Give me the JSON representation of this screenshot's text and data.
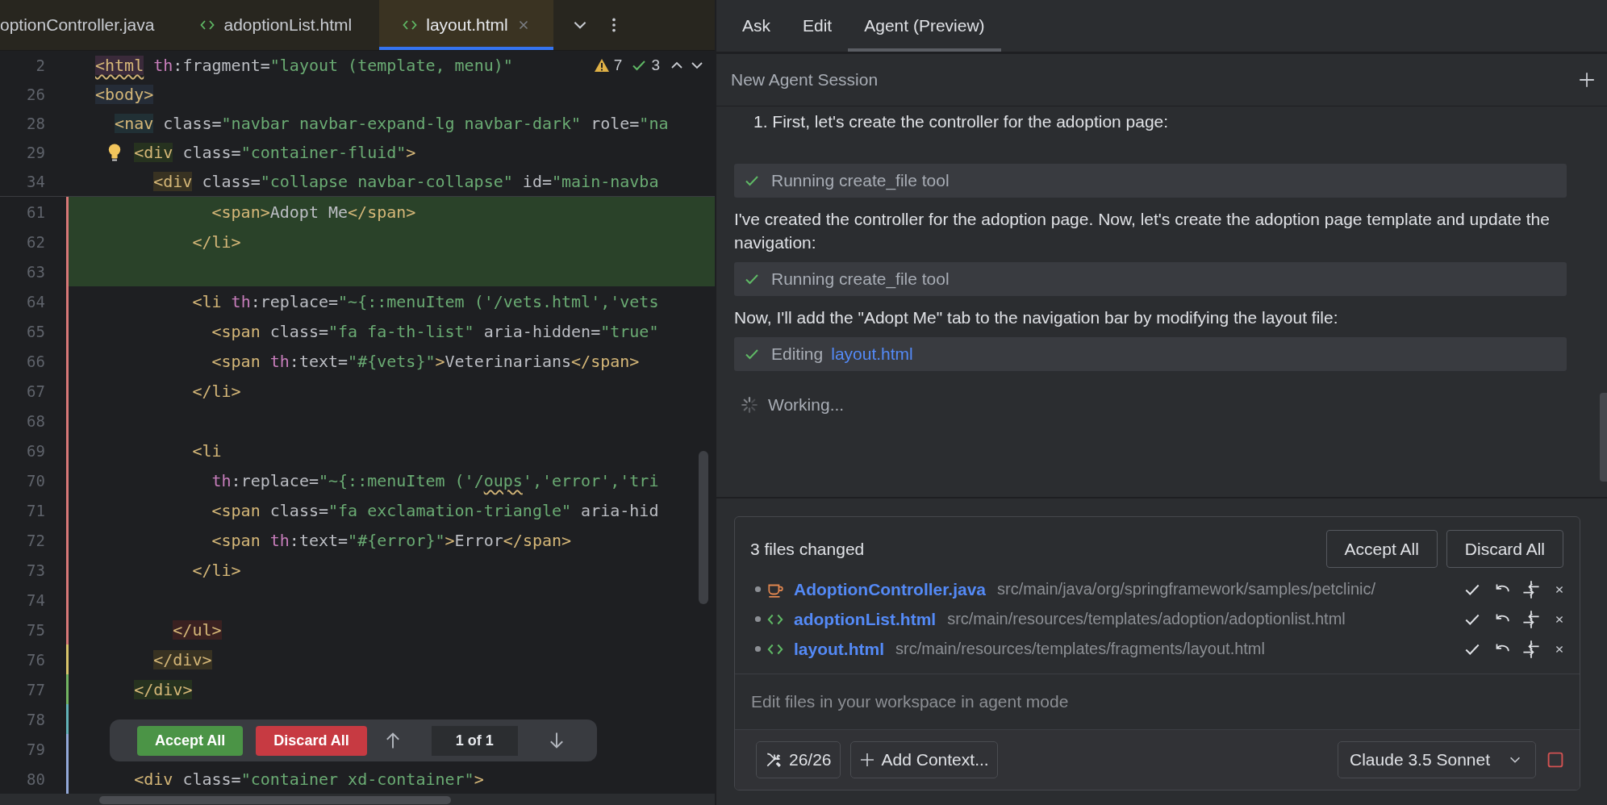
{
  "editor": {
    "tabs": [
      {
        "label": "optionController.java",
        "selected": false
      },
      {
        "label": "adoptionList.html",
        "kind": "html",
        "selected": false
      },
      {
        "label": "layout.html",
        "kind": "html",
        "selected": true
      }
    ],
    "inspections": {
      "warnings": "7",
      "checks": "3"
    },
    "sticky_lines": [
      {
        "number": "2",
        "segments": [
          {
            "kind": "tag",
            "text": "<html",
            "color": "#3a2a3a",
            "squiggly": true
          },
          {
            "kind": "ns",
            "text": " th"
          },
          {
            "kind": "attr",
            "text": ":fragment="
          },
          {
            "kind": "value",
            "text": "\"layout (template, menu)\""
          }
        ]
      },
      {
        "number": "26",
        "segments": [
          {
            "kind": "tag",
            "text": "<body>",
            "color": "#252c37"
          }
        ]
      },
      {
        "number": "28",
        "segments": [
          {
            "kind": "tag",
            "text": "  <nav",
            "color": "#213035"
          },
          {
            "kind": "attr",
            "text": " class="
          },
          {
            "kind": "value",
            "text": "\"navbar navbar-expand-lg navbar-dark\""
          },
          {
            "kind": "attr",
            "text": " role="
          },
          {
            "kind": "value",
            "text": "\"na"
          }
        ]
      },
      {
        "number": "29",
        "bulb": true,
        "segments": [
          {
            "kind": "tag",
            "text": "    <div",
            "color": "#26321f"
          },
          {
            "kind": "attr",
            "text": " class="
          },
          {
            "kind": "value",
            "text": "\"container-fluid\""
          },
          {
            "kind": "tag",
            "text": ">"
          }
        ]
      },
      {
        "number": "34",
        "segments": [
          {
            "kind": "tag",
            "text": "      <div",
            "color": "#383222"
          },
          {
            "kind": "attr",
            "text": " class="
          },
          {
            "kind": "value",
            "text": "\"collapse navbar-collapse\""
          },
          {
            "kind": "attr",
            "text": " id="
          },
          {
            "kind": "value",
            "text": "\"main-navba"
          }
        ]
      }
    ],
    "lines": [
      {
        "number": "61",
        "added": true,
        "color": "#d87878",
        "segments": [
          {
            "kind": "tag",
            "text": "            <span>"
          },
          {
            "kind": "text",
            "text": "Adopt Me"
          },
          {
            "kind": "tag",
            "text": "</span>"
          }
        ]
      },
      {
        "number": "62",
        "added": true,
        "color": "#d87878",
        "segments": [
          {
            "kind": "tag",
            "text": "          </li>"
          }
        ]
      },
      {
        "number": "63",
        "added": true,
        "color": "#d87878"
      },
      {
        "number": "64",
        "added": false,
        "color": "#d87878",
        "segments": [
          {
            "kind": "tag",
            "text": "          <li"
          },
          {
            "kind": "ns",
            "text": " th"
          },
          {
            "kind": "attr",
            "text": ":replace="
          },
          {
            "kind": "value",
            "text": "\"~{::menuItem ('/vets.html','vets"
          }
        ]
      },
      {
        "number": "65",
        "added": false,
        "color": "#d87878",
        "segments": [
          {
            "kind": "tag",
            "text": "            <span"
          },
          {
            "kind": "attr",
            "text": " class="
          },
          {
            "kind": "value",
            "text": "\"fa fa-th-list\""
          },
          {
            "kind": "attr",
            "text": " aria-hidden="
          },
          {
            "kind": "value",
            "text": "\"true\""
          }
        ]
      },
      {
        "number": "66",
        "added": false,
        "color": "#d87878",
        "segments": [
          {
            "kind": "tag",
            "text": "            <span"
          },
          {
            "kind": "ns",
            "text": " th"
          },
          {
            "kind": "attr",
            "text": ":text="
          },
          {
            "kind": "value",
            "text": "\"#{vets}\""
          },
          {
            "kind": "tag",
            "text": ">"
          },
          {
            "kind": "text",
            "text": "Veterinarians"
          },
          {
            "kind": "tag",
            "text": "</span>"
          }
        ]
      },
      {
        "number": "67",
        "added": false,
        "color": "#d87878",
        "segments": [
          {
            "kind": "tag",
            "text": "          </li>"
          }
        ]
      },
      {
        "number": "68",
        "added": false,
        "color": "#d87878"
      },
      {
        "number": "69",
        "added": false,
        "color": "#d87878",
        "segments": [
          {
            "kind": "tag",
            "text": "          <li"
          }
        ]
      },
      {
        "number": "70",
        "added": false,
        "color": "#d87878",
        "segments": [
          {
            "kind": "ns",
            "text": "            th"
          },
          {
            "kind": "attr",
            "text": ":replace="
          },
          {
            "kind": "value",
            "text": "\"~{::menuItem ('/"
          },
          {
            "kind": "value",
            "text": "oups",
            "squiggly": true
          },
          {
            "kind": "value",
            "text": "','error','tri"
          }
        ]
      },
      {
        "number": "71",
        "added": false,
        "color": "#d87878",
        "segments": [
          {
            "kind": "tag",
            "text": "            <span"
          },
          {
            "kind": "attr",
            "text": " class="
          },
          {
            "kind": "value",
            "text": "\"fa exclamation-triangle\""
          },
          {
            "kind": "attr",
            "text": " aria-hid"
          }
        ]
      },
      {
        "number": "72",
        "added": false,
        "color": "#d87878",
        "segments": [
          {
            "kind": "tag",
            "text": "            <span"
          },
          {
            "kind": "ns",
            "text": " th"
          },
          {
            "kind": "attr",
            "text": ":text="
          },
          {
            "kind": "value",
            "text": "\"#{error}\""
          },
          {
            "kind": "tag",
            "text": ">"
          },
          {
            "kind": "text",
            "text": "Error"
          },
          {
            "kind": "tag",
            "text": "</span>"
          }
        ]
      },
      {
        "number": "73",
        "added": false,
        "color": "#d87878",
        "segments": [
          {
            "kind": "tag",
            "text": "          </li>"
          }
        ]
      },
      {
        "number": "74",
        "added": false,
        "color": "#d87878"
      },
      {
        "number": "75",
        "added": false,
        "color": "#d87878",
        "segments": [
          {
            "kind": "tag",
            "text": "        </ul>",
            "color": "#3a2121"
          }
        ]
      },
      {
        "number": "76",
        "added": false,
        "color": "#d8c46a",
        "segments": [
          {
            "kind": "tag",
            "text": "      </div>",
            "color": "#383222"
          }
        ]
      },
      {
        "number": "77",
        "added": false,
        "color": "#72b462",
        "segments": [
          {
            "kind": "tag",
            "text": "    </div>",
            "color": "#26321f"
          }
        ]
      },
      {
        "number": "78",
        "added": false,
        "color": "#62b2b8"
      },
      {
        "number": "79",
        "added": false,
        "color": "#92a8d8"
      },
      {
        "number": "80",
        "added": false,
        "color": "#92a8d8",
        "segments": [
          {
            "kind": "tag",
            "text": "    <div"
          },
          {
            "kind": "attr",
            "text": " class="
          },
          {
            "kind": "value",
            "text": "\"container xd-container\""
          },
          {
            "kind": "tag",
            "text": ">"
          }
        ]
      }
    ],
    "diff_toolbar": {
      "accept": "Accept All",
      "discard": "Discard All",
      "counter": "1 of 1"
    }
  },
  "assistant": {
    "tabs": [
      {
        "label": "Ask",
        "selected": false
      },
      {
        "label": "Edit",
        "selected": false
      },
      {
        "label": "Agent (Preview)",
        "selected": true
      }
    ],
    "session_title": "New Agent Session",
    "messages": [
      {
        "kind": "text",
        "text": "1. First, let's create the controller for the adoption page:"
      },
      {
        "kind": "tool",
        "done": true,
        "label": "Running create_file tool"
      },
      {
        "kind": "text",
        "text": "I've created the controller for the adoption page. Now, let's create the adoption page template and update the navigation:"
      },
      {
        "kind": "tool",
        "done": true,
        "label": "Running create_file tool"
      },
      {
        "kind": "text",
        "text": "Now, I'll add the \"Adopt Me\" tab to the navigation bar by modifying the layout file:"
      },
      {
        "kind": "tool",
        "done": true,
        "label": "Editing",
        "link": "layout.html"
      },
      {
        "kind": "status",
        "text": "Working..."
      }
    ],
    "changes": {
      "title": "3 files changed",
      "accept": "Accept All",
      "discard": "Discard All",
      "files": [
        {
          "kind": "java",
          "name": "AdoptionController.java",
          "path": "src/main/java/org/springframework/samples/petclinic/"
        },
        {
          "kind": "html",
          "name": "adoptionList.html",
          "path": "src/main/resources/templates/adoption/adoptionlist.html"
        },
        {
          "kind": "html",
          "name": "layout.html",
          "path": "src/main/resources/templates/fragments/layout.html"
        }
      ]
    },
    "input": {
      "placeholder": "Edit files in your workspace in agent mode"
    },
    "tools_count": "26/26",
    "add_context": "Add Context...",
    "model": "Claude 3.5 Sonnet"
  }
}
